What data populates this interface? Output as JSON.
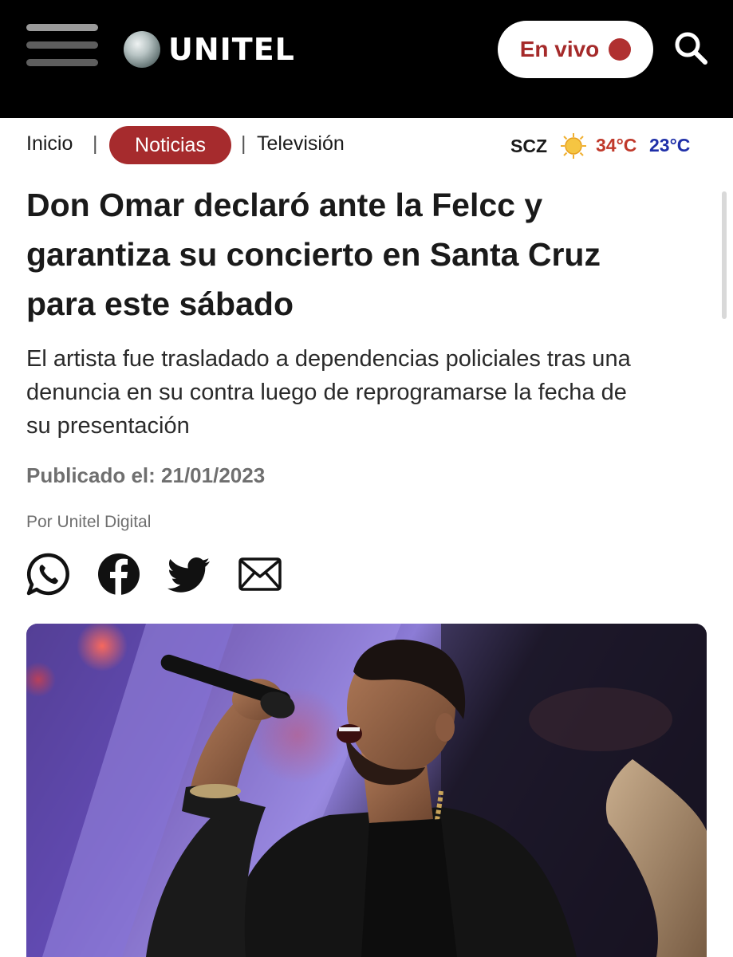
{
  "header": {
    "logo_text": "UNITEL",
    "live_label": "En vivo",
    "live_dot_color": "#b03030"
  },
  "nav": {
    "home": "Inicio",
    "separator": "|",
    "active": "Noticias",
    "tv": "Televisión"
  },
  "weather": {
    "city": "SCZ",
    "high": "34°C",
    "low": "23°C",
    "icon": "sun-icon"
  },
  "article": {
    "headline_lines": [
      "Don Omar declaró ante la Felcc y",
      "garantiza su concierto en Santa Cruz",
      "para este sábado"
    ],
    "subtitle_lines": [
      "El artista fue trasladado a dependencias policiales tras una",
      "denuncia en su contra luego de reprogramarse la fecha de",
      "su presentación"
    ],
    "published": "Publicado el: 21/01/2023",
    "author": "Por Unitel Digital"
  },
  "share_icons": [
    "whatsapp-icon",
    "facebook-icon",
    "twitter-icon",
    "email-icon"
  ],
  "colors": {
    "brand_red": "#a62b2d",
    "temp_high": "#c0392b",
    "temp_low": "#1f2fa8",
    "header_bg": "#000000"
  }
}
